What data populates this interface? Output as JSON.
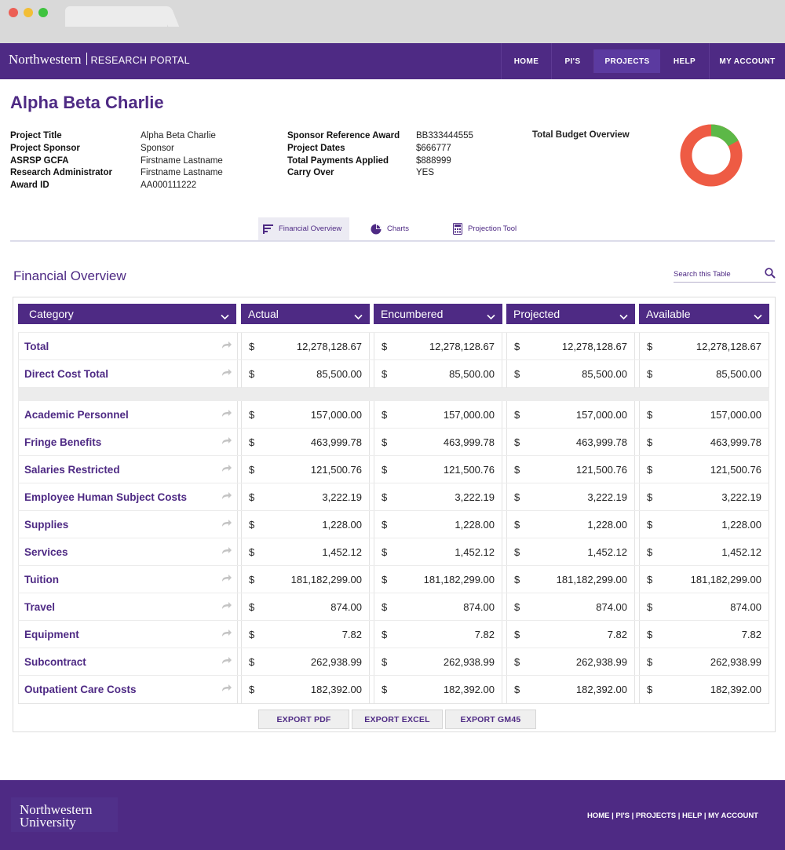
{
  "nav": {
    "logo": "Northwestern",
    "portal": "RESEARCH PORTAL",
    "links": [
      "HOME",
      "PI'S",
      "PROJECTS",
      "HELP",
      "MY ACCOUNT"
    ],
    "active": "PROJECTS"
  },
  "project": {
    "title": "Alpha Beta Charlie",
    "left_fields": [
      {
        "label": "Project Title",
        "value": "Alpha Beta Charlie"
      },
      {
        "label": "Project Sponsor",
        "value": "Sponsor"
      },
      {
        "label": "ASRSP GCFA",
        "value": "Firstname Lastname"
      },
      {
        "label": "Research Administrator",
        "value": "Firstname Lastname"
      },
      {
        "label": "Award ID",
        "value": "AA000111222"
      }
    ],
    "right_fields": [
      {
        "label": "Sponsor Reference Award",
        "value": "BB333444555"
      },
      {
        "label": "Project Dates",
        "value": "$666777"
      },
      {
        "label": "Total Payments Applied",
        "value": "$888999"
      },
      {
        "label": "Carry Over",
        "value": "YES"
      }
    ],
    "budget_label": "Total Budget Overview",
    "budget_chart": {
      "green_fraction": 0.17,
      "green_color": "#5cb847",
      "red_color": "#ee5b44"
    }
  },
  "tabs": [
    {
      "label": "Financial Overview",
      "icon": "bars-icon"
    },
    {
      "label": "Charts",
      "icon": "pie-icon"
    },
    {
      "label": "Projection Tool",
      "icon": "calculator-icon"
    }
  ],
  "section": {
    "title": "Financial Overview",
    "search_placeholder": "Search this Table"
  },
  "table": {
    "columns": [
      "Category",
      "Actual",
      "Encumbered",
      "Projected",
      "Available"
    ],
    "currency": "$",
    "rows": [
      {
        "category": "Total",
        "values": [
          "12,278,128.67",
          "12,278,128.67",
          "12,278,128.67",
          "12,278,128.67"
        ]
      },
      {
        "category": "Direct Cost Total",
        "values": [
          "85,500.00",
          "85,500.00",
          "85,500.00",
          "85,500.00"
        ]
      },
      {
        "category": "Academic Personnel",
        "values": [
          "157,000.00",
          "157,000.00",
          "157,000.00",
          "157,000.00"
        ]
      },
      {
        "category": "Fringe Benefits",
        "values": [
          "463,999.78",
          "463,999.78",
          "463,999.78",
          "463,999.78"
        ]
      },
      {
        "category": "Salaries Restricted",
        "values": [
          "121,500.76",
          "121,500.76",
          "121,500.76",
          "121,500.76"
        ]
      },
      {
        "category": "Employee Human Subject Costs",
        "values": [
          "3,222.19",
          "3,222.19",
          "3,222.19",
          "3,222.19"
        ]
      },
      {
        "category": "Supplies",
        "values": [
          "1,228.00",
          "1,228.00",
          "1,228.00",
          "1,228.00"
        ]
      },
      {
        "category": "Services",
        "values": [
          "1,452.12",
          "1,452.12",
          "1,452.12",
          "1,452.12"
        ]
      },
      {
        "category": "Tuition",
        "values": [
          "181,182,299.00",
          "181,182,299.00",
          "181,182,299.00",
          "181,182,299.00"
        ]
      },
      {
        "category": "Travel",
        "values": [
          "874.00",
          "874.00",
          "874.00",
          "874.00"
        ]
      },
      {
        "category": "Equipment",
        "values": [
          "7.82",
          "7.82",
          "7.82",
          "7.82"
        ]
      },
      {
        "category": "Subcontract",
        "values": [
          "262,938.99",
          "262,938.99",
          "262,938.99",
          "262,938.99"
        ]
      },
      {
        "category": "Outpatient Care Costs",
        "values": [
          "182,392.00",
          "182,392.00",
          "182,392.00",
          "182,392.00"
        ]
      }
    ]
  },
  "exports": [
    "EXPORT PDF",
    "EXPORT EXCEL",
    "EXPORT GM45"
  ],
  "footer": {
    "logo_line1": "Northwestern",
    "logo_line2": "University",
    "links": "HOME | PI'S | PROJECTS | HELP | MY ACCOUNT"
  }
}
